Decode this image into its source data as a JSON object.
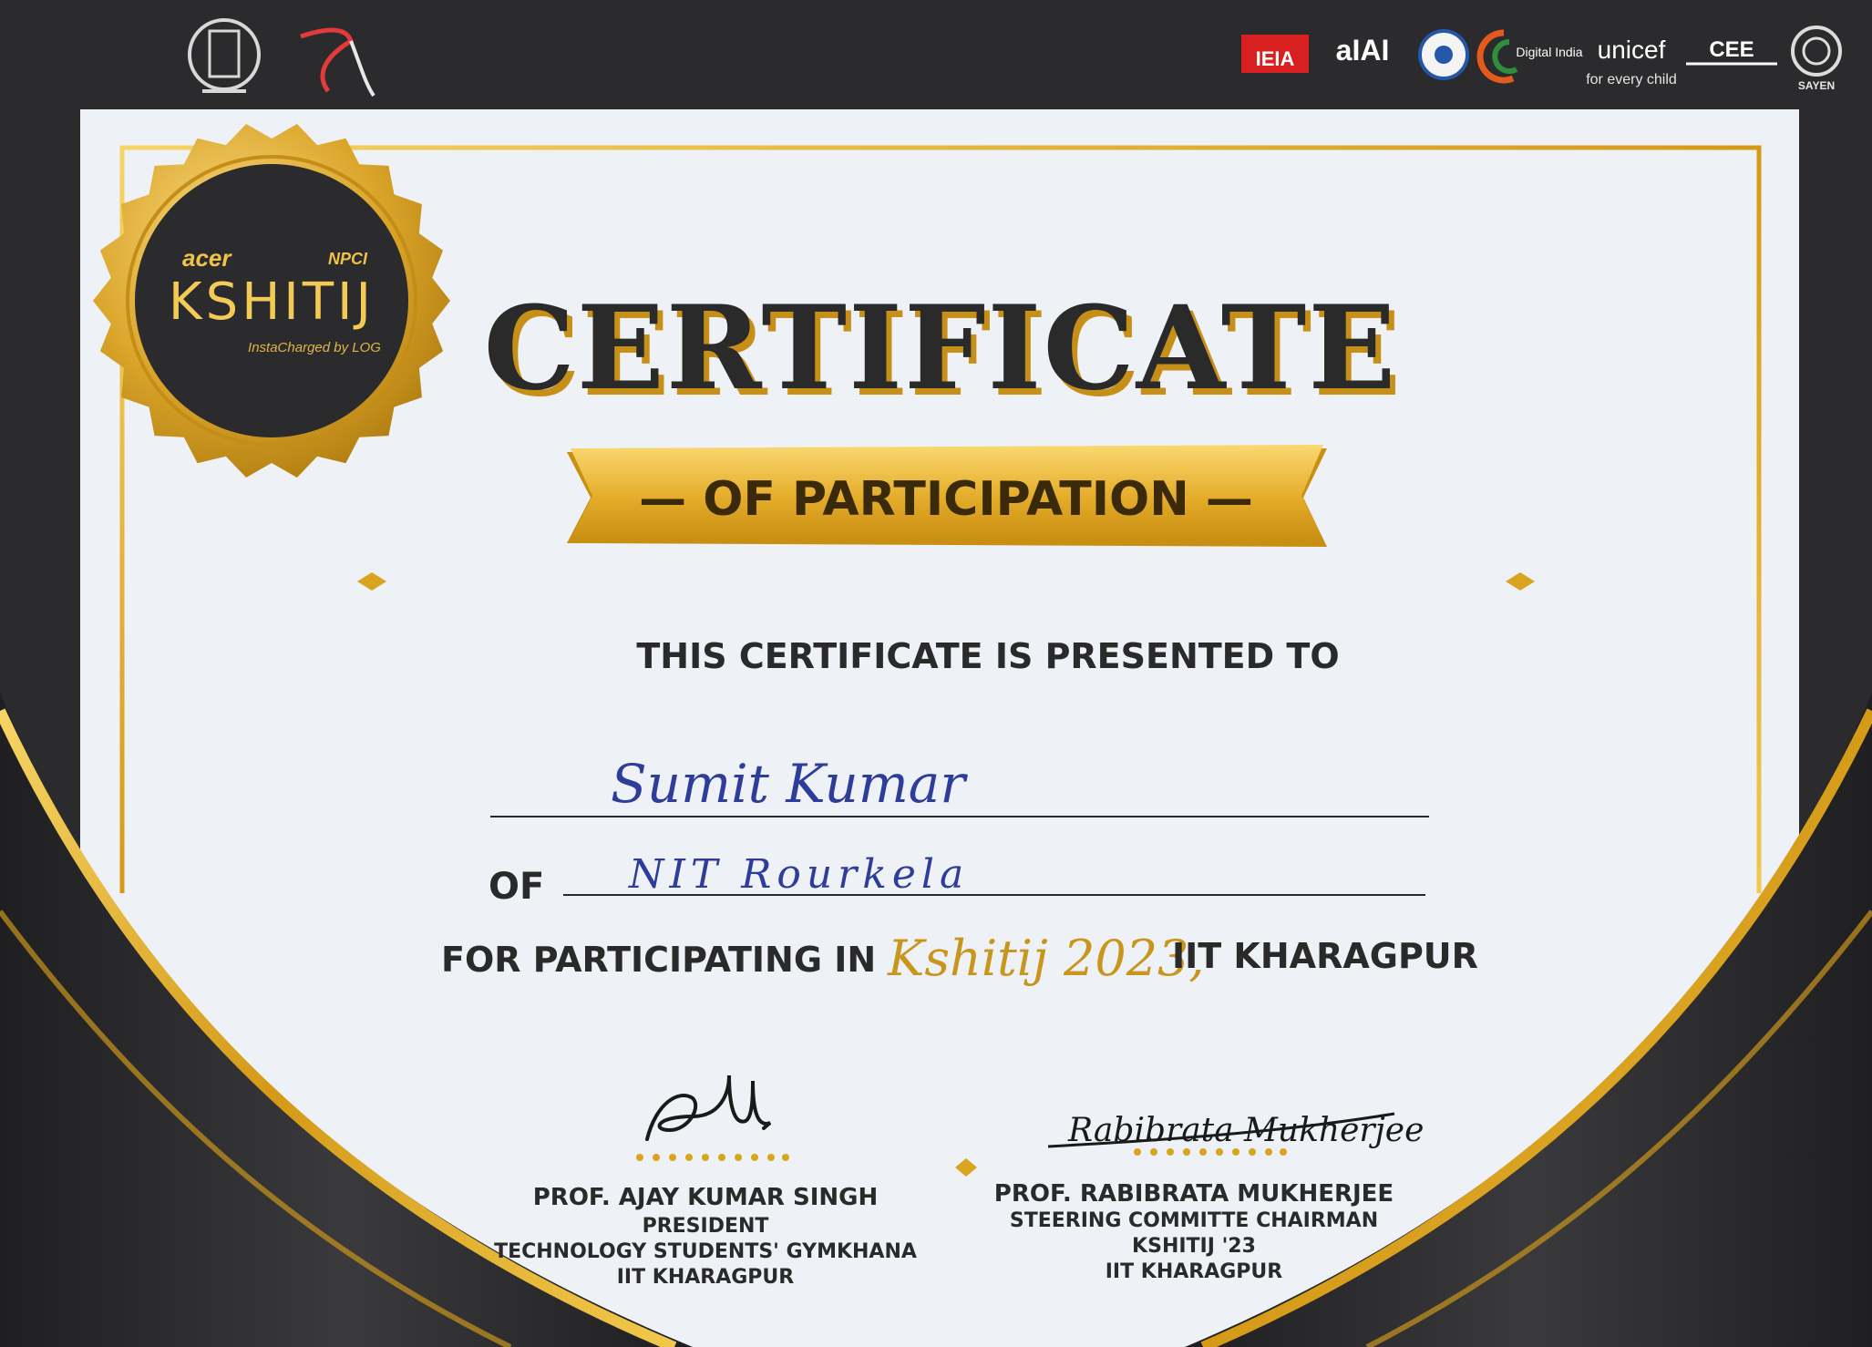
{
  "sponsor_logos": {
    "left": [
      "iit-kgp-crest-logo",
      "ktj-logo"
    ],
    "right": [
      "ieia-logo",
      "aiai-logo",
      "gov-emblem-logo",
      "digital-india-logo",
      "unicef-logo",
      "cee-logo",
      "sayen-logo"
    ],
    "ieia_text": "IEIA",
    "aiai_text": "aIAI",
    "unicef_text": "unicef",
    "unicef_sub": "for every child",
    "cee_text": "CEE",
    "sayen_text": "SAYEN",
    "digital_india_text": "Digital India"
  },
  "badge": {
    "brand": "acer",
    "partner": "NPCI",
    "event": "KSHITIJ",
    "tagline": "InstaCharged by LOG"
  },
  "certificate": {
    "title": "CERTIFICATE",
    "subtitle": "— OF PARTICIPATION —",
    "presented_to": "THIS CERTIFICATE IS PRESENTED TO",
    "recipient_name": "Sumit Kumar",
    "of_label": "OF",
    "institution": "NIT Rourkela",
    "participating_prefix": "FOR PARTICIPATING IN",
    "event_script": "Kshitij 2023,",
    "participating_suffix": "IIT KHARAGPUR"
  },
  "signatories": [
    {
      "name": "PROF. AJAY KUMAR SINGH",
      "role": "PRESIDENT",
      "org": "TECHNOLOGY STUDENTS' GYMKHANA",
      "institute": "IIT KHARAGPUR"
    },
    {
      "name": "PROF. RABIBRATA MUKHERJEE",
      "role": "STEERING COMMITTE CHAIRMAN",
      "org": "KSHITIJ '23",
      "institute": "IIT KHARAGPUR",
      "signature_text": "Rabibrata Mukherjee"
    }
  ],
  "colors": {
    "frame_dark": "#2b2a2c",
    "paper": "#eef1f6",
    "gold": "#d9a521",
    "gold_light": "#f3c84a",
    "ribbon_text": "#3a2a0a",
    "ink": "#2f3d9a"
  }
}
